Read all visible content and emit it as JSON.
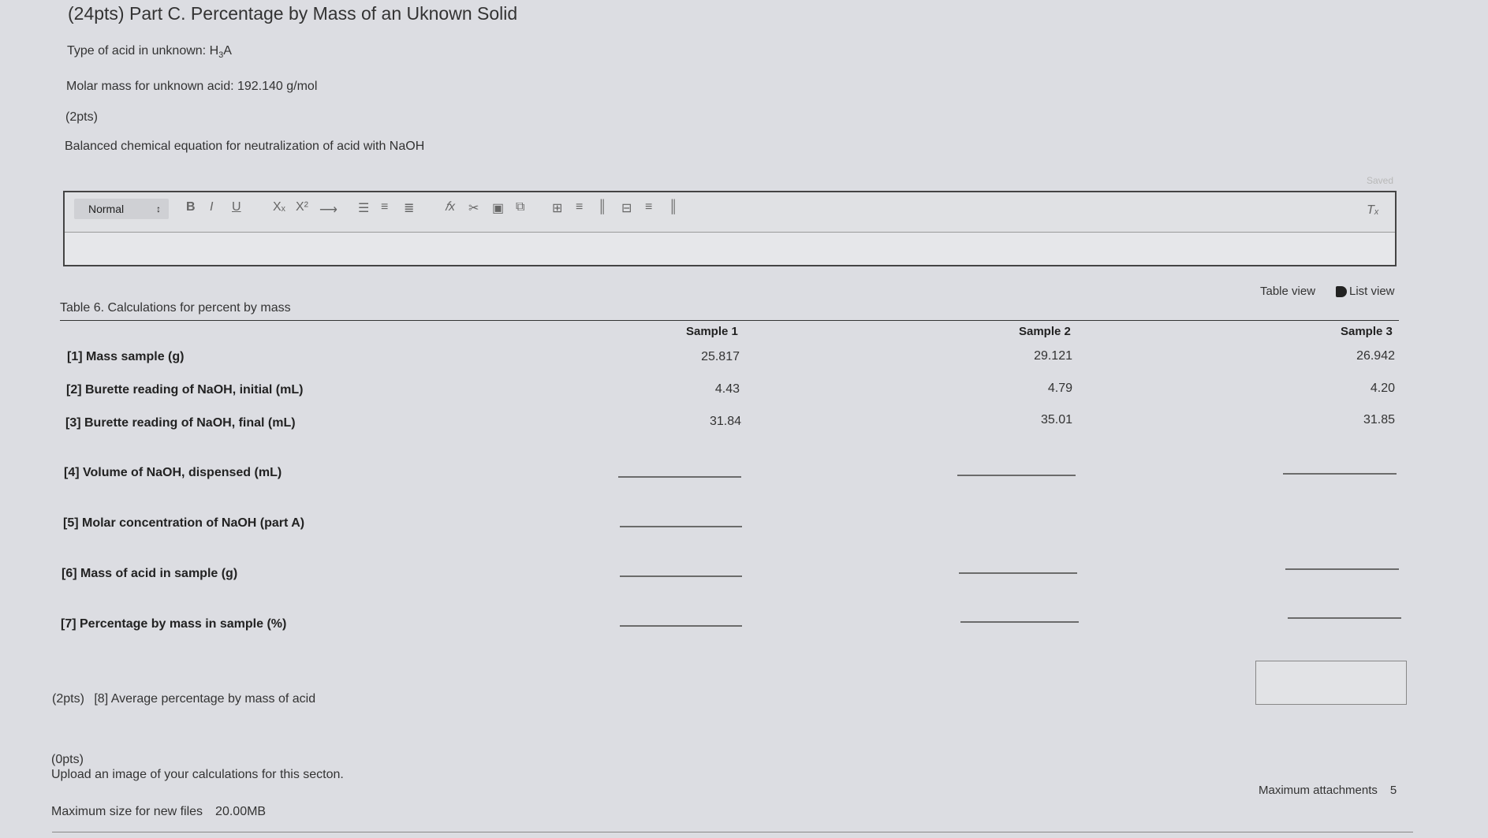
{
  "section_title": "(24pts) Part C. Percentage by Mass of an Uknown Solid",
  "acid_type": {
    "label": "Type of acid in unknown:",
    "formula_prefix": "H",
    "formula_sub": "3",
    "formula_suffix": "A"
  },
  "molar_mass": "Molar mass for unknown acid: 192.140 g/mol",
  "equation_points": "(2pts)",
  "equation_prompt": "Balanced chemical equation for neutralization of acid with NaOH",
  "editor": {
    "format_select": "Normal",
    "format_arrow": "↕",
    "buttons": {
      "bold": "B",
      "italic": "I",
      "underline": "U",
      "subscript": "Xₓ",
      "superscript": "X²",
      "arrow": "⟶",
      "ordered_list": "☰",
      "unordered_list": "≡",
      "align": "≣",
      "formula": "𝑓x",
      "link": "✂",
      "image": "▣",
      "embed": "⧉",
      "table": "⊞",
      "row_above": "≡",
      "col_left": "║",
      "merge": "⊟",
      "row_below": "≡",
      "col_right": "║",
      "clear_format": "Tₓ"
    },
    "content": ""
  },
  "saved_label": "Saved",
  "view_toggle": {
    "table_view": "Table view",
    "list_view": "List view"
  },
  "table": {
    "caption": "Table 6. Calculations for percent by mass",
    "columns": [
      "Sample 1",
      "Sample 2",
      "Sample 3"
    ],
    "rows": [
      {
        "label": "[1] Mass sample (g)",
        "values": [
          "25.817",
          "29.121",
          "26.942"
        ]
      },
      {
        "label": "[2] Burette reading of NaOH, initial (mL)",
        "values": [
          "4.43",
          "4.79",
          "4.20"
        ]
      },
      {
        "label": "[3] Burette reading of NaOH, final (mL)",
        "values": [
          "31.84",
          "35.01",
          "31.85"
        ]
      },
      {
        "label": "[4] Volume of NaOH, dispensed (mL)",
        "inputs": [
          "",
          "",
          ""
        ]
      },
      {
        "label": "[5] Molar concentration of NaOH (part A)",
        "inputs": [
          ""
        ]
      },
      {
        "label": "[6] Mass of acid in sample (g)",
        "inputs": [
          "",
          "",
          ""
        ]
      },
      {
        "label": "[7] Percentage by mass in sample (%)",
        "inputs": [
          "",
          "",
          ""
        ]
      }
    ]
  },
  "average": {
    "points": "(2pts)",
    "label": "[8] Average percentage by mass of acid",
    "value": ""
  },
  "upload": {
    "points": "(0pts)",
    "prompt": "Upload an image of your calculations for this secton.",
    "max_size_label": "Maximum size for new files",
    "max_size_value": "20.00MB",
    "max_attachments_label": "Maximum attachments",
    "max_attachments_value": "5"
  }
}
